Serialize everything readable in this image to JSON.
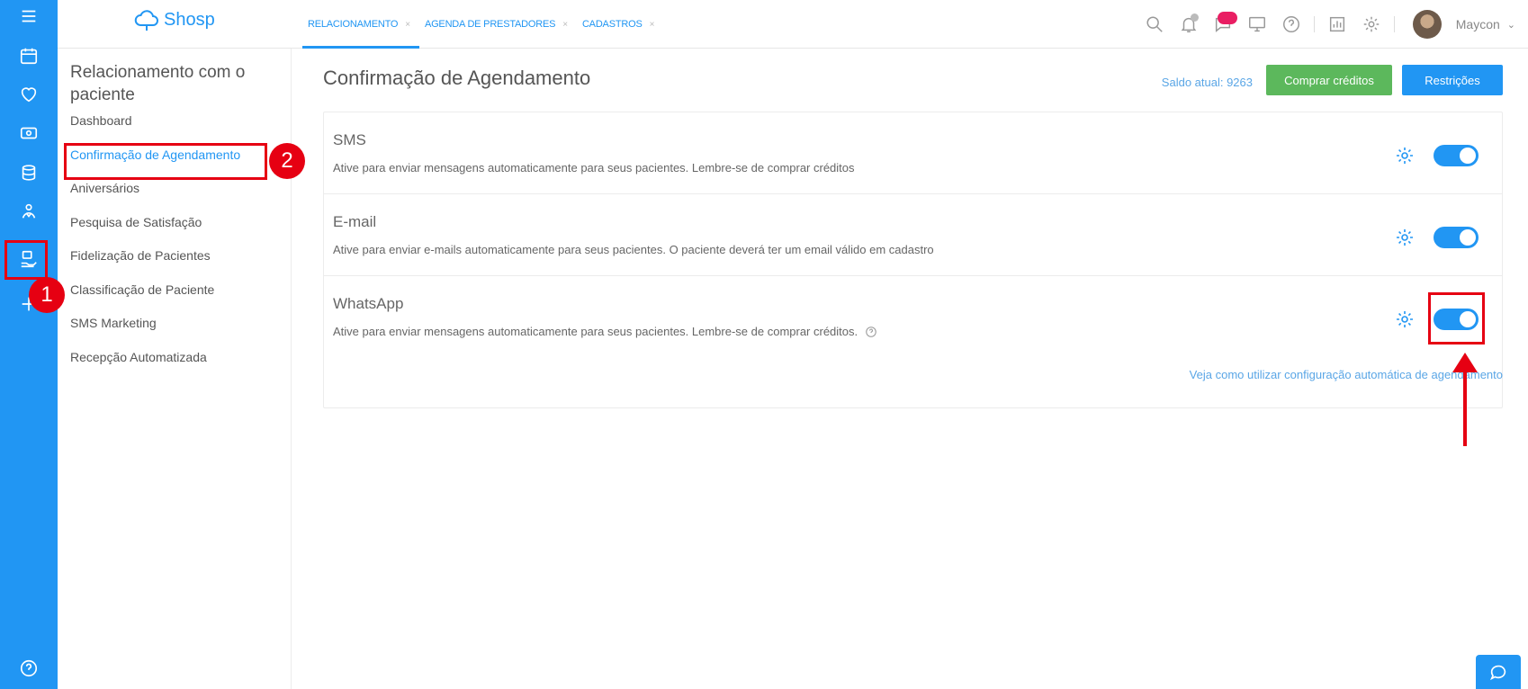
{
  "colors": {
    "primary": "#2196f3",
    "green": "#5cb85c",
    "annotation": "#e60012",
    "badge": "#e91e63"
  },
  "rail": {
    "icons": [
      "menu-icon",
      "calendar-icon",
      "heart-icon",
      "money-icon",
      "database-icon",
      "doctor-icon",
      "relationship-icon",
      "plus-icon",
      "help-icon"
    ],
    "active": "relationship-icon"
  },
  "logo": {
    "text": "Shosp"
  },
  "tabs": [
    {
      "label": "RELACIONAMENTO",
      "active": true
    },
    {
      "label": "AGENDA DE PRESTADORES",
      "active": false
    },
    {
      "label": "CADASTROS",
      "active": false
    }
  ],
  "tab_close": "×",
  "topbar": {
    "icons": [
      "search-icon",
      "bell-icon",
      "chat-icon",
      "monitor-icon",
      "help-icon",
      "report-icon",
      "gear-icon"
    ],
    "user_name": "Maycon",
    "user_chevron": "⌄"
  },
  "subnav": {
    "title": "Relacionamento com o paciente",
    "items": [
      {
        "label": "Dashboard",
        "active": false
      },
      {
        "label": "Confirmação de Agendamento",
        "active": true
      },
      {
        "label": "Aniversários",
        "active": false
      },
      {
        "label": "Pesquisa de Satisfação",
        "active": false
      },
      {
        "label": "Fidelização de Pacientes",
        "active": false
      },
      {
        "label": "Classificação de Paciente",
        "active": false
      },
      {
        "label": "SMS Marketing",
        "active": false
      },
      {
        "label": "Recepção Automatizada",
        "active": false
      }
    ]
  },
  "main": {
    "title": "Confirmação de Agendamento",
    "saldo": "Saldo atual: 9263",
    "buy_button": "Comprar créditos",
    "restrictions_button": "Restrições",
    "channels": [
      {
        "title": "SMS",
        "description": "Ative para enviar mensagens automaticamente para seus pacientes. Lembre-se de comprar créditos",
        "enabled": true,
        "help": false
      },
      {
        "title": "E-mail",
        "description": "Ative para enviar e-mails automaticamente para seus pacientes. O paciente deverá ter um email válido em cadastro",
        "enabled": true,
        "help": false
      },
      {
        "title": "WhatsApp",
        "description": "Ative para enviar mensagens automaticamente para seus pacientes. Lembre-se de comprar créditos.",
        "enabled": true,
        "help": true
      }
    ],
    "help_link": "Veja como utilizar configuração automática de agendamento"
  },
  "annotations": {
    "step1": "1",
    "step2": "2"
  }
}
